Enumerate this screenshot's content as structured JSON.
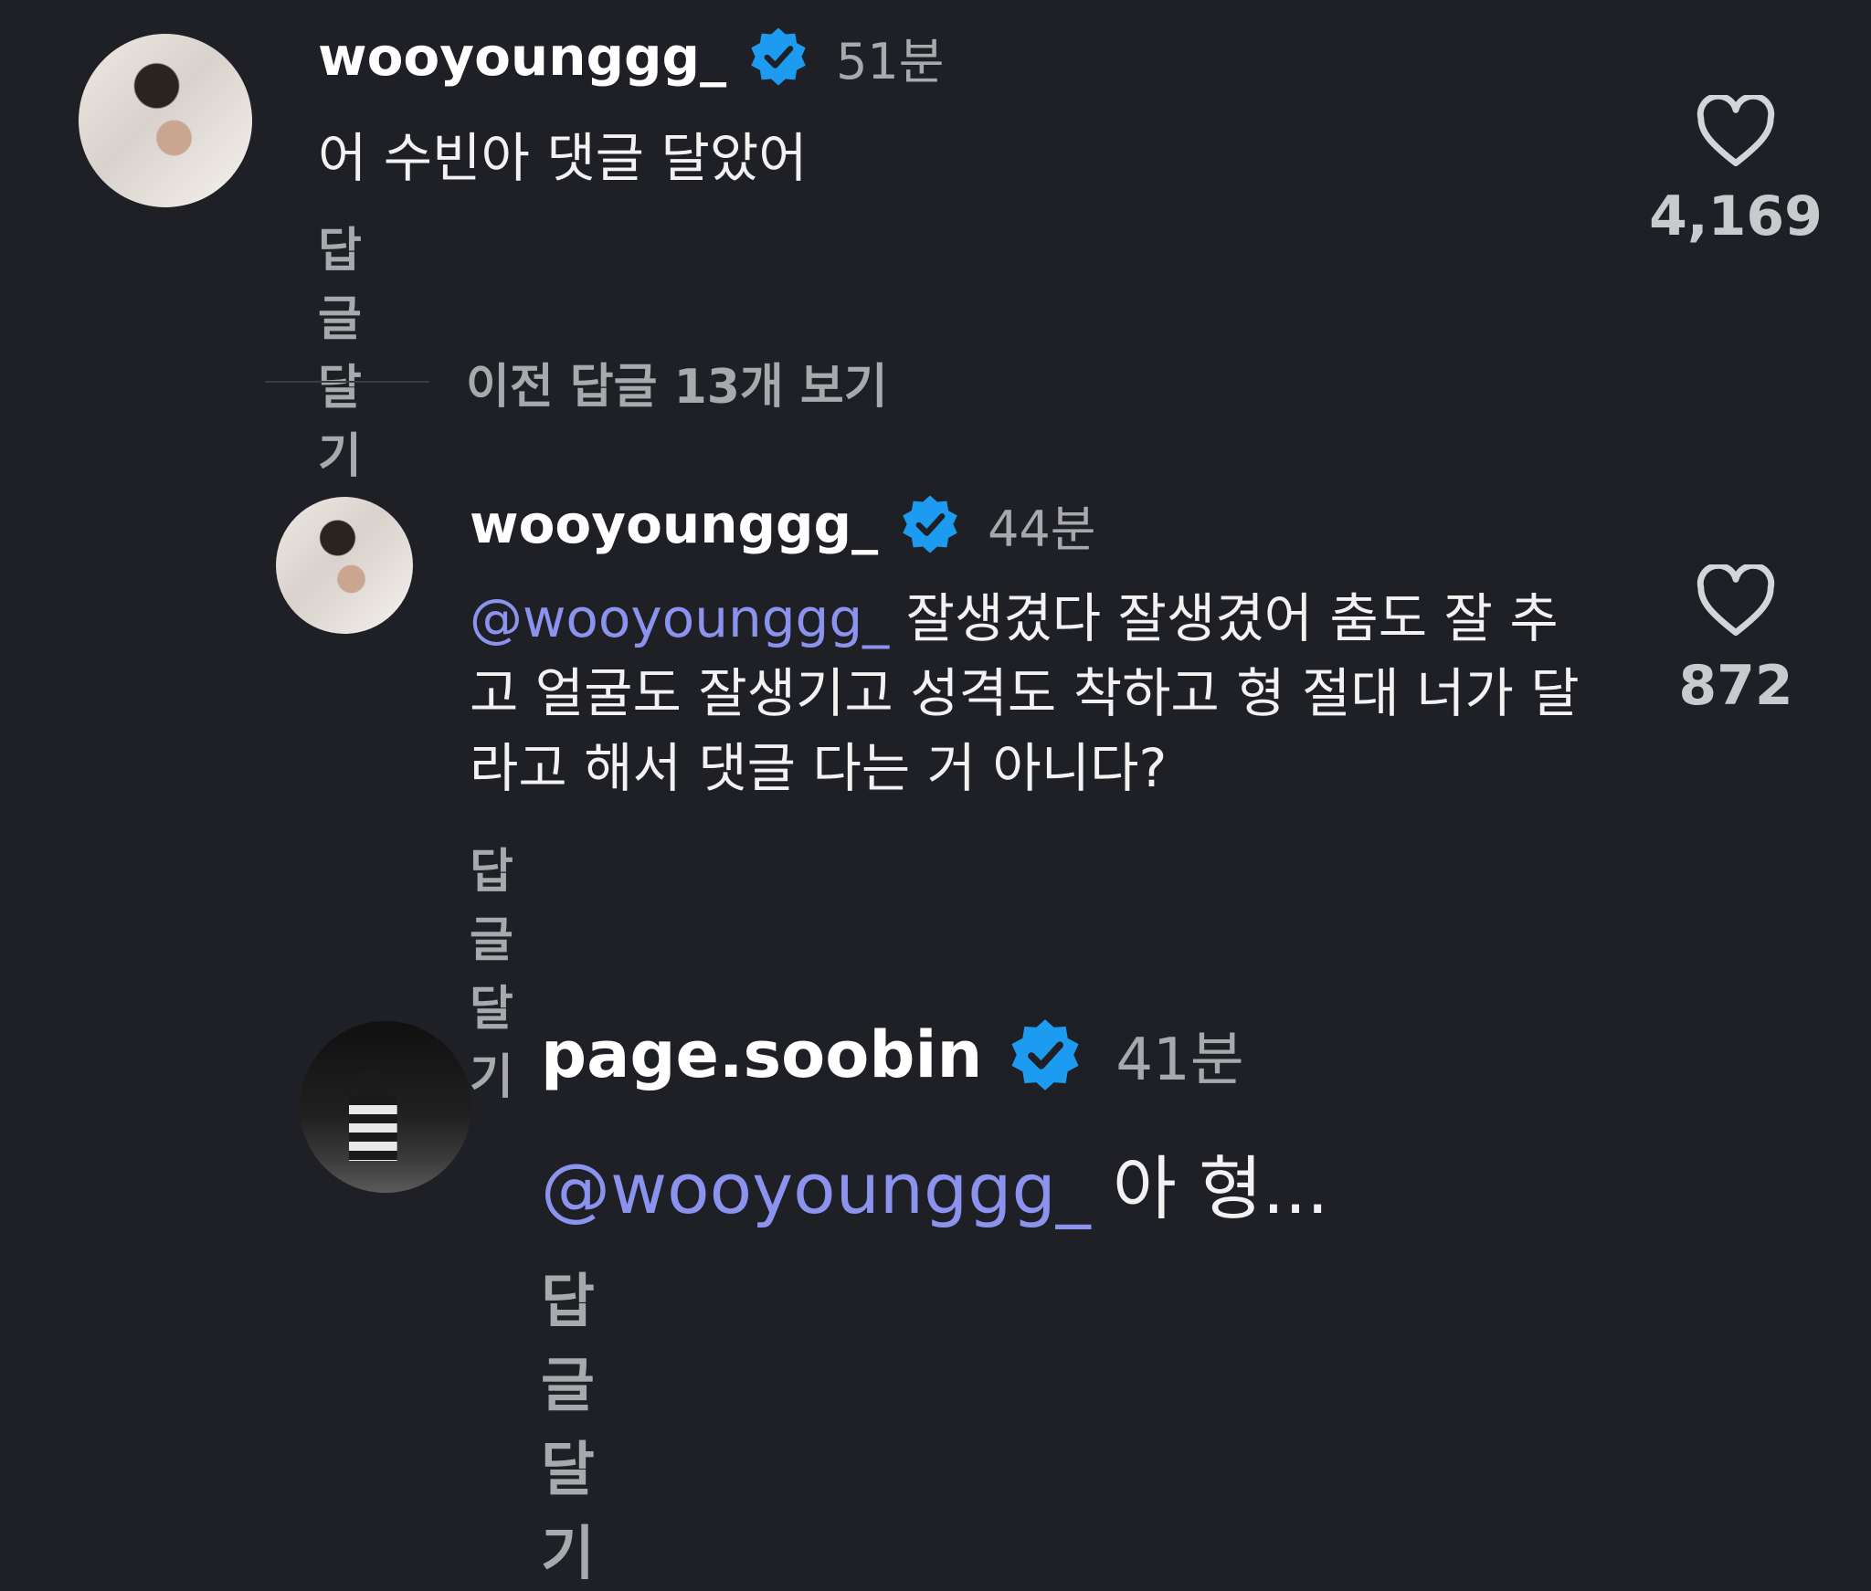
{
  "comments": [
    {
      "username": "wooyounggg_",
      "time": "51분",
      "text": "어 수빈아 댓글 달았어",
      "reply_label": "답글 달기",
      "like_count": "4,169"
    },
    {
      "username": "wooyounggg_",
      "time": "44분",
      "mention": "@wooyounggg_",
      "text": " 잘생겼다 잘생겼어 춤도 잘 추고 얼굴도 잘생기고 성격도 착하고 형 절대 너가 달라고 해서 댓글 다는 거 아니다?",
      "reply_label": "답글 달기",
      "like_count": "872"
    },
    {
      "username": "page.soobin",
      "time": "41분",
      "mention": "@wooyounggg_",
      "text": " 아 형...",
      "reply_label": "답글 달기"
    }
  ],
  "view_replies_label": "이전 답글 13개 보기",
  "colors": {
    "background": "#1f2025",
    "mention": "#8b93ee",
    "verified_badge": "#1d9bf0",
    "secondary_text": "#a8a9ad"
  },
  "icons": {
    "verified": "verified-badge-icon",
    "like": "heart-outline-icon"
  }
}
